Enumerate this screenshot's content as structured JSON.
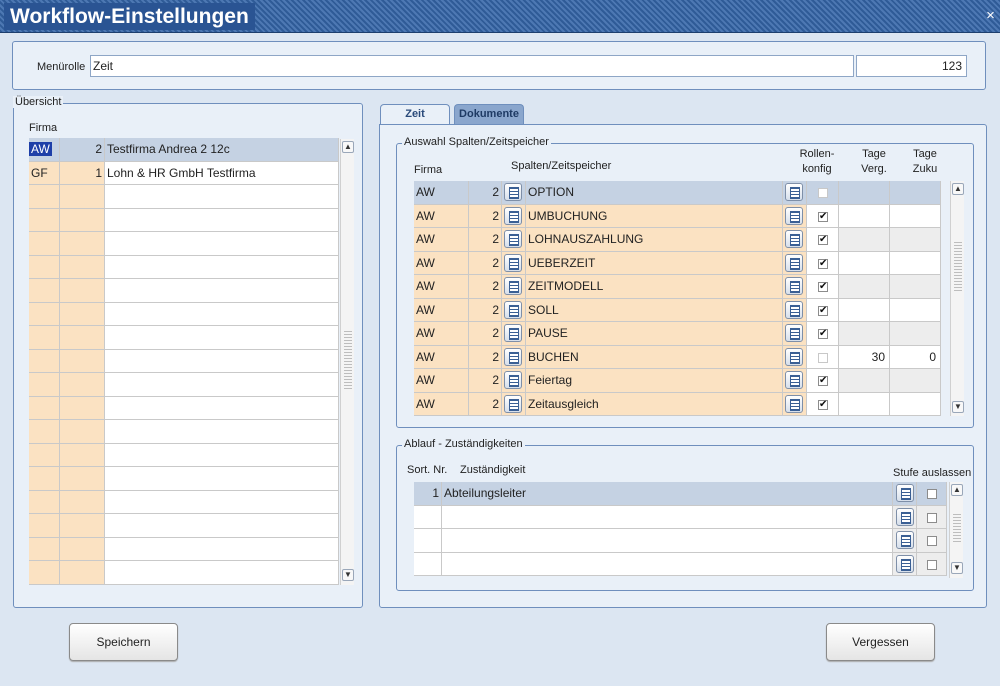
{
  "window": {
    "title": "Workflow-Einstellungen",
    "close_icon": "×"
  },
  "menurolle": {
    "label": "Menürolle",
    "value": "Zeit",
    "number": "123"
  },
  "uebersicht": {
    "title": "Übersicht",
    "col_firma": "Firma",
    "rows": [
      {
        "code": "AW",
        "num": "2",
        "name": "Testfirma Andrea 2 12c"
      },
      {
        "code": "GF",
        "num": "1",
        "name": "Lohn & HR GmbH Testfirma"
      }
    ]
  },
  "tabs": [
    {
      "label": "Zeit"
    },
    {
      "label": "Dokumente"
    }
  ],
  "auswahl": {
    "title": "Auswahl Spalten/Zeitspeicher",
    "col_firma": "Firma",
    "col_spalten": "Spalten/Zeitspeicher",
    "col_rollen1": "Rollen-",
    "col_rollen2": "konfig",
    "col_tage_verg1": "Tage",
    "col_tage_verg2": "Verg.",
    "col_tage_zuku1": "Tage",
    "col_tage_zuku2": "Zuku",
    "rows": [
      {
        "firma": "AW",
        "num": "2",
        "name": "OPTION",
        "checked": false,
        "verg": "",
        "zuku": ""
      },
      {
        "firma": "AW",
        "num": "2",
        "name": "UMBUCHUNG",
        "checked": true,
        "verg": "",
        "zuku": ""
      },
      {
        "firma": "AW",
        "num": "2",
        "name": "LOHNAUSZAHLUNG",
        "checked": true,
        "verg": "",
        "zuku": ""
      },
      {
        "firma": "AW",
        "num": "2",
        "name": "UEBERZEIT",
        "checked": true,
        "verg": "",
        "zuku": ""
      },
      {
        "firma": "AW",
        "num": "2",
        "name": "ZEITMODELL",
        "checked": true,
        "verg": "",
        "zuku": ""
      },
      {
        "firma": "AW",
        "num": "2",
        "name": "SOLL",
        "checked": true,
        "verg": "",
        "zuku": ""
      },
      {
        "firma": "AW",
        "num": "2",
        "name": "PAUSE",
        "checked": true,
        "verg": "",
        "zuku": ""
      },
      {
        "firma": "AW",
        "num": "2",
        "name": "BUCHEN",
        "checked": false,
        "verg": "30",
        "zuku": "0"
      },
      {
        "firma": "AW",
        "num": "2",
        "name": "Feiertag",
        "checked": true,
        "verg": "",
        "zuku": ""
      },
      {
        "firma": "AW",
        "num": "2",
        "name": "Zeitausgleich",
        "checked": true,
        "verg": "",
        "zuku": ""
      }
    ]
  },
  "ablauf": {
    "title": "Ablauf - Zuständigkeiten",
    "col_sort": "Sort. Nr.",
    "col_zust": "Zuständigkeit",
    "col_stufe": "Stufe auslassen",
    "rows": [
      {
        "nr": "1",
        "name": "Abteilungsleiter"
      },
      {
        "nr": "",
        "name": ""
      },
      {
        "nr": "",
        "name": ""
      },
      {
        "nr": "",
        "name": ""
      }
    ]
  },
  "buttons": {
    "save": "Speichern",
    "forget": "Vergessen"
  },
  "check_glyph": "✔"
}
